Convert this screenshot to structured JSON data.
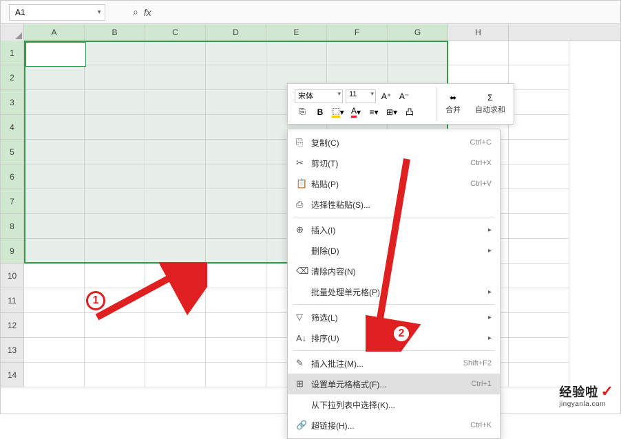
{
  "name_box": "A1",
  "mini_toolbar": {
    "font_name": "宋体",
    "font_size": "11",
    "merge_label": "合并",
    "autosum_label": "自动求和"
  },
  "columns": [
    "A",
    "B",
    "C",
    "D",
    "E",
    "F",
    "G",
    "H"
  ],
  "rows": [
    "1",
    "2",
    "3",
    "4",
    "5",
    "6",
    "7",
    "8",
    "9",
    "10",
    "11",
    "12",
    "13",
    "14"
  ],
  "menu": {
    "copy": "复制(C)",
    "copy_sc": "Ctrl+C",
    "cut": "剪切(T)",
    "cut_sc": "Ctrl+X",
    "paste": "粘贴(P)",
    "paste_sc": "Ctrl+V",
    "paste_special": "选择性粘贴(S)...",
    "insert": "插入(I)",
    "delete": "删除(D)",
    "clear": "清除内容(N)",
    "batch": "批量处理单元格(P)",
    "filter": "筛选(L)",
    "sort": "排序(U)",
    "comment": "插入批注(M)...",
    "comment_sc": "Shift+F2",
    "format": "设置单元格格式(F)...",
    "format_sc": "Ctrl+1",
    "dropdown": "从下拉列表中选择(K)...",
    "hyperlink": "超链接(H)...",
    "hyperlink_sc": "Ctrl+K"
  },
  "badges": {
    "one": "1",
    "two": "2"
  },
  "watermark": {
    "top": "经验啦",
    "bottom": "jingyanla.com",
    "check": "✓"
  }
}
